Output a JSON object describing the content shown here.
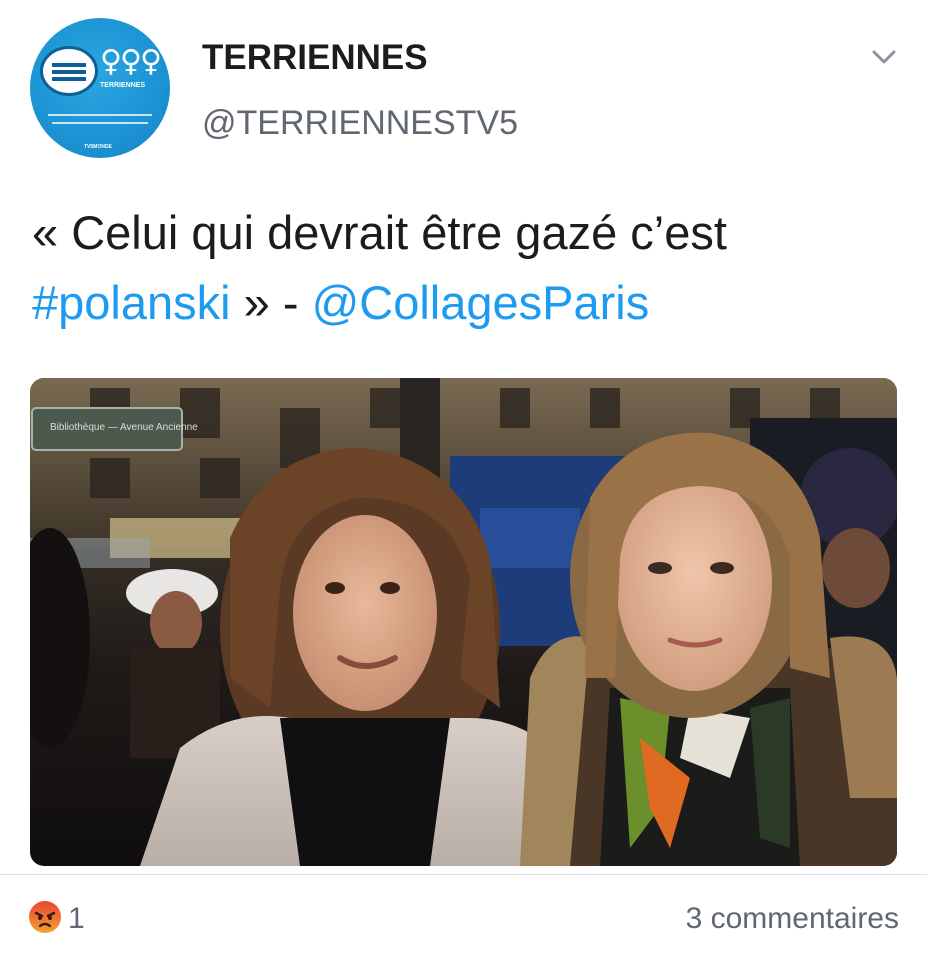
{
  "account": {
    "name": "TERRIENNES",
    "handle": "@TERRIENNESTV5",
    "avatar_brand": "TERRIENNES",
    "avatar_footer": "TV5MONDE"
  },
  "tweet": {
    "text_main": "« Celui qui devrait être gazé c’est",
    "hashtag": "#polanski",
    "separator": " » - ",
    "mention": "@CollagesParis"
  },
  "media": {
    "sign_text": "Bibliothèque — Avenue Ancienne"
  },
  "footer": {
    "reaction_icon": "angry-face-icon",
    "reaction_count": "1",
    "comments": "3 commentaires"
  },
  "colors": {
    "link": "#1d9bf0",
    "muted": "#606770",
    "avatar": "#1a8fd0",
    "angry": "#f0772f"
  }
}
